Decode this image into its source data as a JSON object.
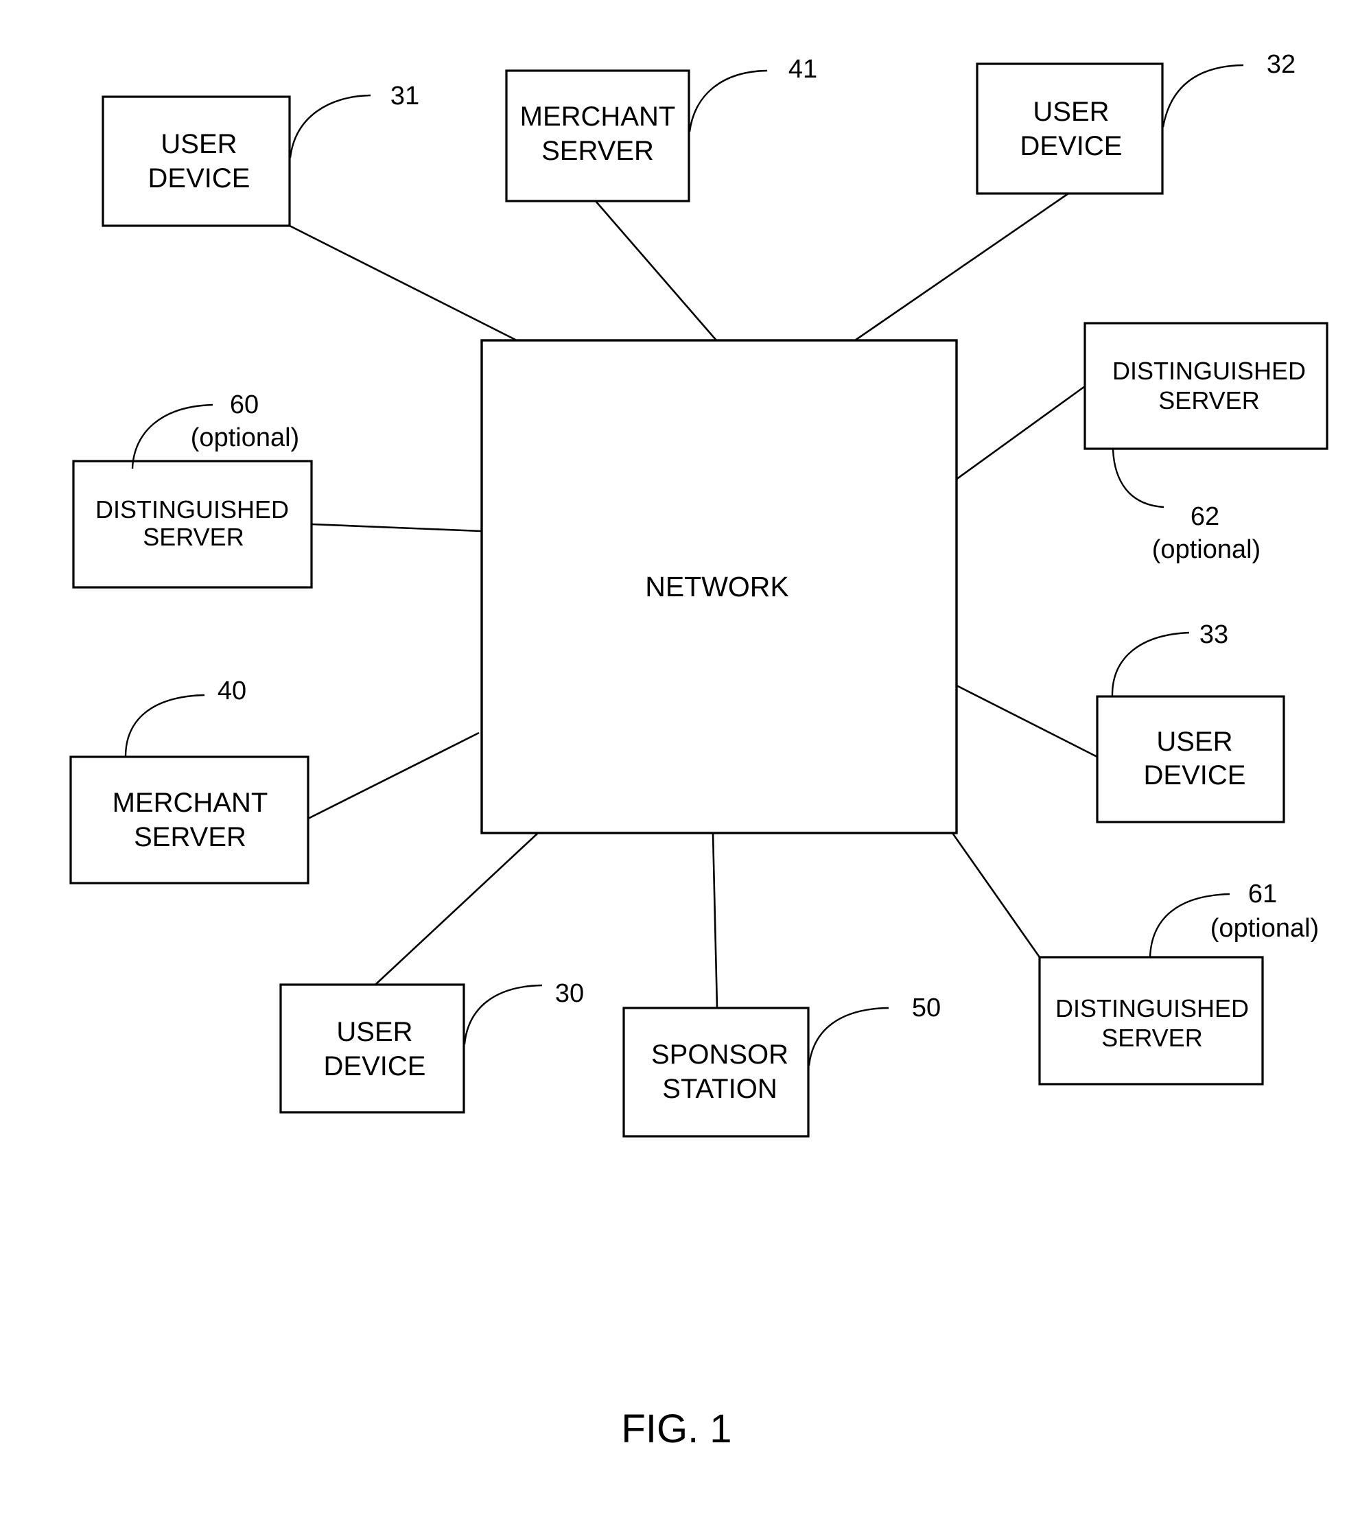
{
  "figure": {
    "caption": "FIG. 1",
    "hub": {
      "id": "network",
      "label": "NETWORK"
    },
    "nodes": [
      {
        "id": "user-device-31",
        "ref": "31",
        "lines": [
          "USER",
          "DEVICE"
        ],
        "optional": false
      },
      {
        "id": "merchant-server-41",
        "ref": "41",
        "lines": [
          "MERCHANT",
          "SERVER"
        ],
        "optional": false
      },
      {
        "id": "user-device-32",
        "ref": "32",
        "lines": [
          "USER",
          "DEVICE"
        ],
        "optional": false
      },
      {
        "id": "distinguished-server-62",
        "ref": "62",
        "lines": [
          "DISTINGUISHED",
          "SERVER"
        ],
        "optional": true
      },
      {
        "id": "user-device-33",
        "ref": "33",
        "lines": [
          "USER",
          "DEVICE"
        ],
        "optional": false
      },
      {
        "id": "distinguished-server-61",
        "ref": "61",
        "lines": [
          "DISTINGUISHED",
          "SERVER"
        ],
        "optional": true
      },
      {
        "id": "sponsor-station-50",
        "ref": "50",
        "lines": [
          "SPONSOR",
          "STATION"
        ],
        "optional": false
      },
      {
        "id": "user-device-30",
        "ref": "30",
        "lines": [
          "USER",
          "DEVICE"
        ],
        "optional": false
      },
      {
        "id": "merchant-server-40",
        "ref": "40",
        "lines": [
          "MERCHANT",
          "SERVER"
        ],
        "optional": false
      },
      {
        "id": "distinguished-server-60",
        "ref": "60",
        "lines": [
          "DISTINGUISHED",
          "SERVER"
        ],
        "optional": true
      }
    ],
    "optional_label": "(optional)",
    "connections": [
      [
        "network",
        "user-device-31"
      ],
      [
        "network",
        "merchant-server-41"
      ],
      [
        "network",
        "user-device-32"
      ],
      [
        "network",
        "distinguished-server-62"
      ],
      [
        "network",
        "user-device-33"
      ],
      [
        "network",
        "distinguished-server-61"
      ],
      [
        "network",
        "sponsor-station-50"
      ],
      [
        "network",
        "user-device-30"
      ],
      [
        "network",
        "merchant-server-40"
      ],
      [
        "network",
        "distinguished-server-60"
      ]
    ]
  }
}
